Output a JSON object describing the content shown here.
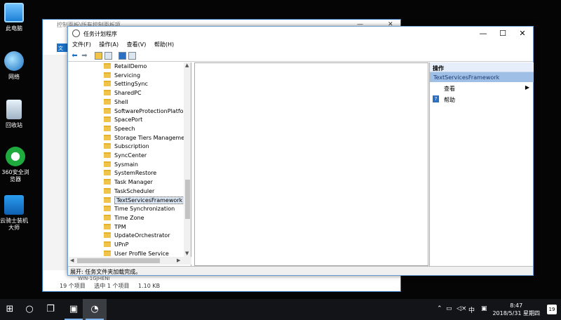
{
  "desktop": {
    "icons": [
      {
        "label": "此电脑",
        "icon": "this-pc-icon"
      },
      {
        "label": "网络",
        "icon": "network-icon"
      },
      {
        "label": "回收站",
        "icon": "recycle-bin-icon"
      },
      {
        "label": "360安全浏览器",
        "icon": "360-browser-icon"
      },
      {
        "label": "云骑士装机大师",
        "icon": "yunqishi-icon"
      }
    ]
  },
  "back_window": {
    "title": "控制面板\\所有控制面板项",
    "file_tab": "文",
    "host": "WIN-1GJHENI",
    "status_items": "19 个项目",
    "status_selected": "选中 1 个项目",
    "status_size": "1.10 KB"
  },
  "window": {
    "title": "任务计划程序",
    "menu": [
      "文件(F)",
      "操作(A)",
      "查看(V)",
      "帮助(H)"
    ],
    "tree": [
      "RetailDemo",
      "Servicing",
      "SettingSync",
      "SharedPC",
      "Shell",
      "SoftwareProtectionPlatform",
      "SpacePort",
      "Speech",
      "Storage Tiers Management",
      "Subscription",
      "SyncCenter",
      "Sysmain",
      "SystemRestore",
      "Task Manager",
      "TaskScheduler",
      "TextServicesFramework",
      "Time Synchronization",
      "Time Zone",
      "TPM",
      "UpdateOrchestrator",
      "UPnP",
      "User Profile Service"
    ],
    "selected_index": 15,
    "actions": {
      "header": "操作",
      "selected": "TextServicesFramework",
      "view": "查看",
      "help": "帮助"
    },
    "status": "展开: 任务文件夹加载完成。"
  },
  "taskbar": {
    "ime": "中",
    "time": "8:47",
    "date": "2018/5/31 星期四",
    "notifications": "19"
  }
}
